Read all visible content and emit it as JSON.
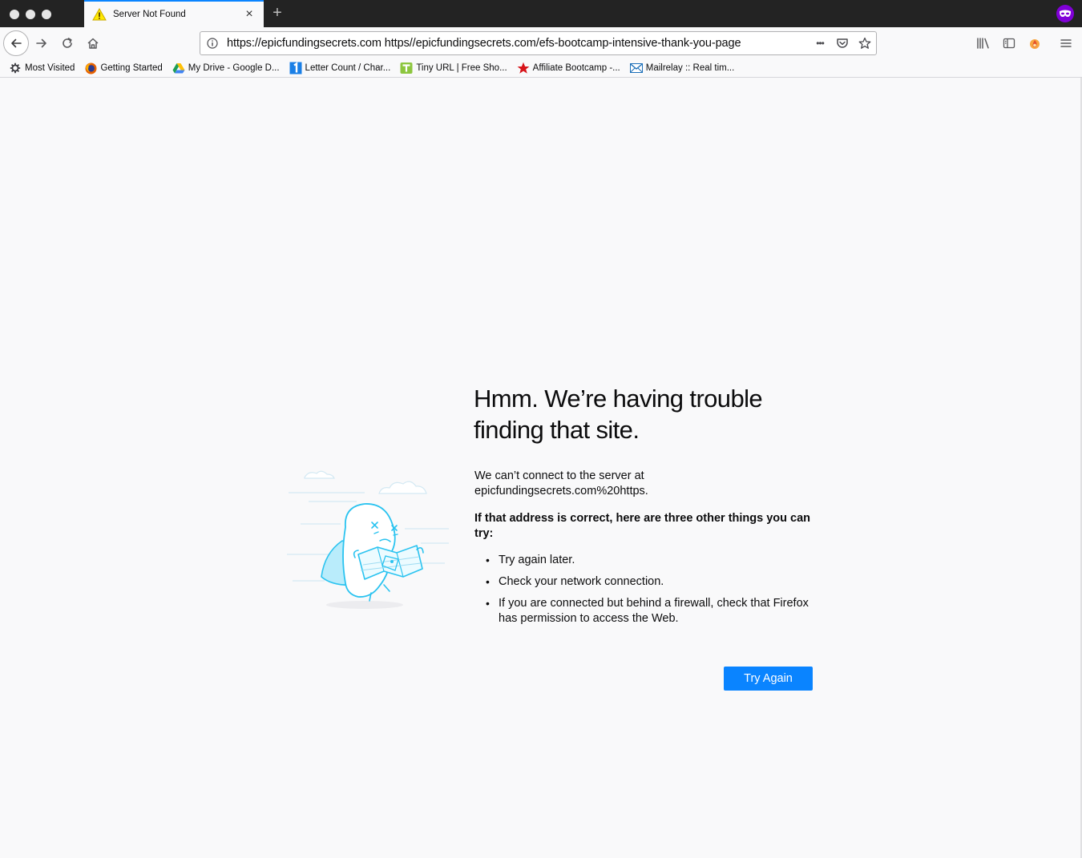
{
  "tab": {
    "title": "Server Not Found",
    "close_glyph": "×",
    "new_tab_glyph": "+"
  },
  "urlbar": {
    "url": "https://epicfundingsecrets.com https//epicfundingsecrets.com/efs-bootcamp-intensive-thank-you-page",
    "page_actions_glyph": "•••"
  },
  "bookmarks": [
    {
      "label": "Most Visited",
      "icon": "gear-icon"
    },
    {
      "label": "Getting Started",
      "icon": "firefox-icon"
    },
    {
      "label": "My Drive - Google D...",
      "icon": "google-drive-icon"
    },
    {
      "label": "Letter Count / Char...",
      "icon": "number-one-icon"
    },
    {
      "label": "Tiny URL | Free Sho...",
      "icon": "tinyurl-icon"
    },
    {
      "label": "Affiliate Bootcamp -...",
      "icon": "red-star-icon"
    },
    {
      "label": "Mailrelay :: Real tim...",
      "icon": "mail-icon"
    }
  ],
  "error": {
    "title": "Hmm. We’re having trouble finding that site.",
    "description": "We can’t connect to the server at epicfundingsecrets.com%20https.",
    "subheading": "If that address is correct, here are three other things you can try:",
    "tips": [
      "Try again later.",
      "Check your network connection.",
      "If you are connected but behind a firewall, check that Firefox has permission to access the Web."
    ],
    "try_again_label": "Try Again"
  },
  "colors": {
    "accent": "#0a84ff",
    "titlebar": "#232323",
    "page_background": "#f9f9fa",
    "private_browsing": "#8000d7",
    "illustration_stroke": "#2ac3f0"
  }
}
